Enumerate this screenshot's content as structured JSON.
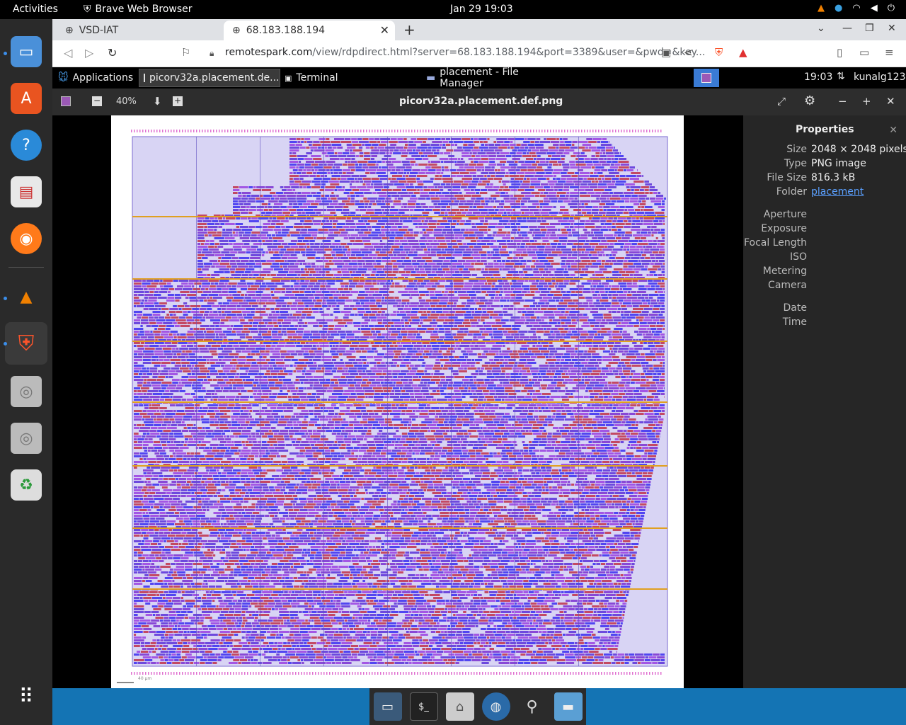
{
  "topbar": {
    "activities": "Activities",
    "app_name": "Brave Web Browser",
    "clock": "Jan 29  19:03"
  },
  "browser": {
    "tabs": [
      {
        "label": "VSD-IAT"
      },
      {
        "label": "68.183.188.194"
      }
    ],
    "url_host": "remotespark.com",
    "url_rest": "/view/rdpdirect.html?server=68.183.188.194&port=3389&user=&pwd=&key..."
  },
  "xpanel": {
    "applications": "Applications",
    "tasks": [
      {
        "label": "picorv32a.placement.de..."
      },
      {
        "label": "Terminal"
      },
      {
        "label": "placement - File Manager"
      }
    ],
    "time": "19:03",
    "user": "kunalg123"
  },
  "viewer": {
    "zoom": "40%",
    "title": "picorv32a.placement.def.png",
    "scale_label": "40 µm"
  },
  "properties": {
    "title": "Properties",
    "rows": [
      {
        "key": "Size",
        "value": "2048 × 2048 pixels"
      },
      {
        "key": "Type",
        "value": "PNG image"
      },
      {
        "key": "File Size",
        "value": "816.3 kB"
      },
      {
        "key": "Folder",
        "value": "placement"
      }
    ],
    "exif_keys": [
      "Aperture",
      "Exposure",
      "Focal Length",
      "ISO",
      "Metering",
      "Camera"
    ],
    "date_keys": [
      "Date",
      "Time"
    ]
  },
  "colors": {
    "cell_purple": "#7a2fd0",
    "cell_blue": "#3a2cf0",
    "cell_red": "#c0304a",
    "power_rail": "#e0a020",
    "accent_link": "#5aa0ff"
  }
}
